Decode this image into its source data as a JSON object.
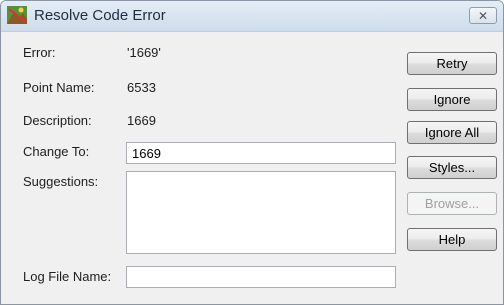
{
  "window": {
    "title": "Resolve Code Error",
    "close_glyph": "✕",
    "icon": "app-icon"
  },
  "fields": {
    "error_label": "Error:",
    "error_value": "'1669'",
    "point_name_label": "Point Name:",
    "point_name_value": "6533",
    "description_label": "Description:",
    "description_value": "1669",
    "change_to_label": "Change To:",
    "change_to_value": "1669",
    "suggestions_label": "Suggestions:",
    "log_file_label": "Log File Name:",
    "log_file_value": ""
  },
  "buttons": {
    "retry": "Retry",
    "ignore": "Ignore",
    "ignore_all": "Ignore All",
    "styles": "Styles...",
    "browse": "Browse...",
    "help": "Help"
  },
  "colors": {
    "disabled_text": "#a0a0a0"
  }
}
